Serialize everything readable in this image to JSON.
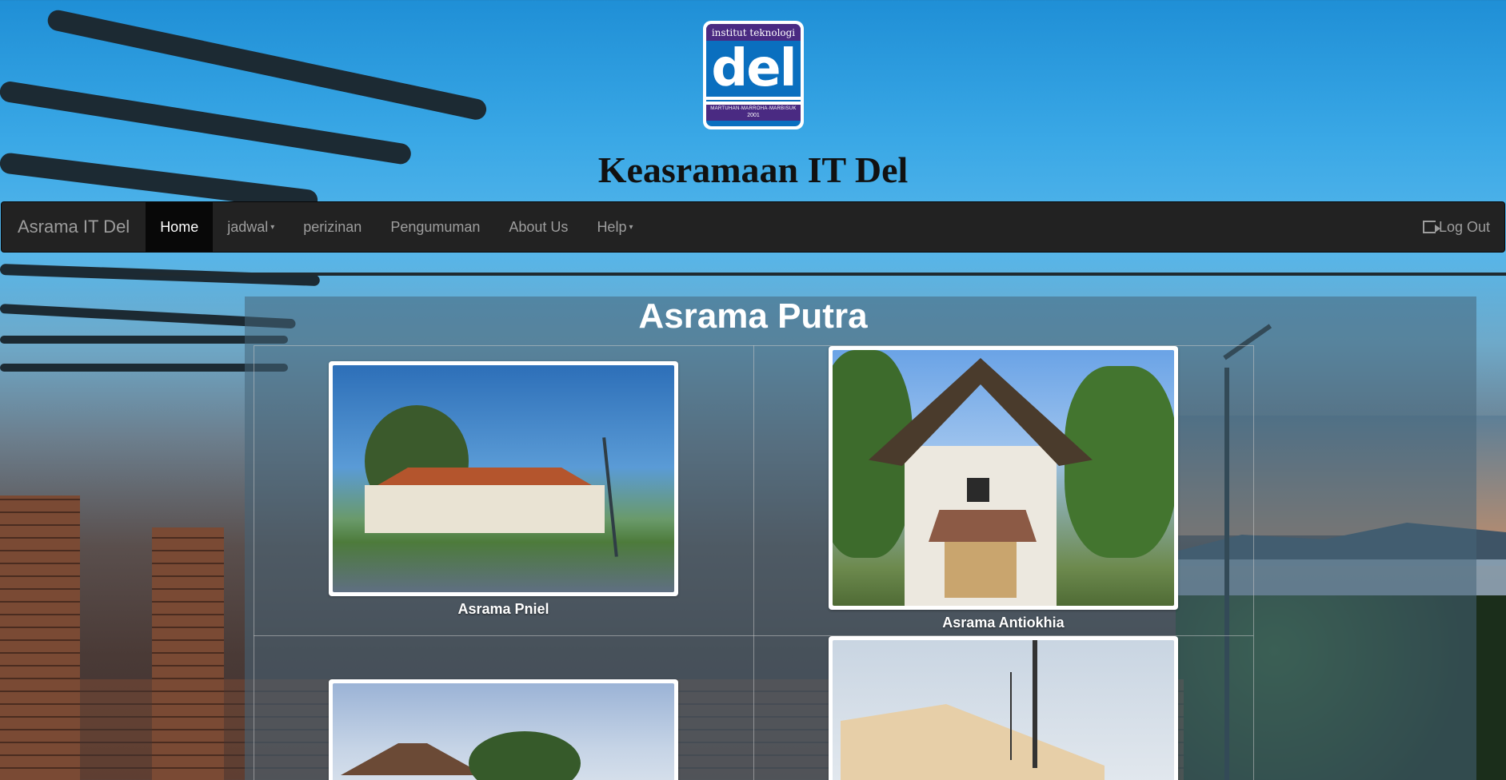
{
  "header": {
    "logo": {
      "top_text": "institut teknologi",
      "mark": "del",
      "motto": "MARTUHAN·MARROHA·MARBISUK",
      "year": "2001"
    },
    "title": "Keasramaan IT Del"
  },
  "navbar": {
    "brand": "Asrama IT Del",
    "items": [
      {
        "label": "Home",
        "active": true
      },
      {
        "label": "jadwal",
        "dropdown": true
      },
      {
        "label": "perizinan"
      },
      {
        "label": "Pengumuman"
      },
      {
        "label": "About Us"
      },
      {
        "label": "Help",
        "dropdown": true
      }
    ],
    "logout_label": "Log Out",
    "caret": "▾"
  },
  "main": {
    "title": "Asrama Putra",
    "dorms": [
      {
        "name": "Asrama Pniel"
      },
      {
        "name": "Asrama Antiokhia"
      },
      {
        "name": ""
      },
      {
        "name": ""
      }
    ]
  },
  "colors": {
    "navbar_bg": "#222222",
    "nav_active_bg": "#080808",
    "nav_text": "#9d9d9d",
    "logo_purple": "#4a2a82",
    "logo_blue": "#0a6fbf"
  }
}
